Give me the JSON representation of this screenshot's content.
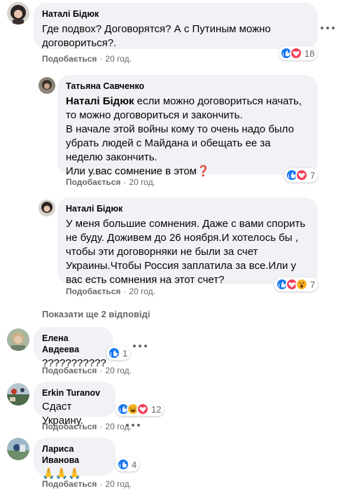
{
  "comments": [
    {
      "author": "Наталі Бідюк",
      "text": "Где подвох? Договорятся? А с Путиным можно договориться?.",
      "like_label": "Подобається",
      "time": "20 год.",
      "reactions": [
        "like",
        "love"
      ],
      "reaction_count": "18"
    },
    {
      "author": "Татьяна Савченко",
      "mention": "Наталі Бідюк",
      "text": " если можно договориться начать, то можно договориться и закончить.\nВ начале этой войны кому то очень надо было убрать людей с Майдана и обещать ее за неделю закончить.\nИли у.вас сомнение в этом❓",
      "like_label": "Подобається",
      "time": "20 год.",
      "reactions": [
        "like",
        "love"
      ],
      "reaction_count": "7"
    },
    {
      "author": "Наталі Бідюк",
      "text": "У меня большие сомнения. Даже с вами спорить не буду. Доживем до 26 ноября.И хотелось бы , чтобы эти договорняки не были за счет Украины.Чтобы Россия заплатила за все.Или у вас есть сомнения на этот счет?",
      "like_label": "Подобається",
      "time": "20 год.",
      "reactions": [
        "like",
        "love",
        "wow"
      ],
      "reaction_count": "7"
    },
    {
      "author": "Елена Авдеева",
      "text": "???????????",
      "like_label": "Подобається",
      "time": "20 год.",
      "reactions": [
        "like"
      ],
      "reaction_count": "1"
    },
    {
      "author": "Erkin Turanov",
      "text": "Сдаст Украину.",
      "like_label": "Подобається",
      "time": "20 год.",
      "reactions": [
        "like",
        "haha",
        "love"
      ],
      "reaction_count": "12"
    },
    {
      "author": "Лариса Иванова",
      "text": "🙏🙏🙏",
      "like_label": "Подобається",
      "time": "20 год.",
      "reactions": [
        "like"
      ],
      "reaction_count": "4"
    }
  ],
  "more_replies": "Показати ще 2 відповіді",
  "separator": "·",
  "colors": {
    "like": "#1877f2",
    "love": "#f33e58",
    "haha": "#f7b125",
    "bubble": "#f0f2f5",
    "meta": "#65676b"
  }
}
